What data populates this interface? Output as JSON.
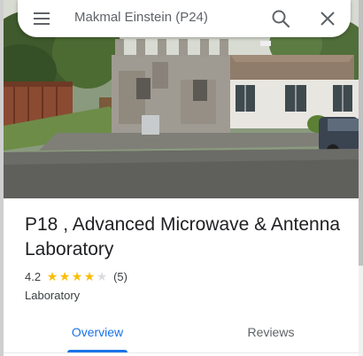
{
  "search": {
    "query": "Makmal Einstein (P24)"
  },
  "icons": {
    "menu": "hamburger-menu-icon",
    "search": "search-icon",
    "close": "close-icon"
  },
  "place": {
    "title": "P18 , Advanced Microwave & Antenna Laboratory",
    "rating": "4.2",
    "stars": 4,
    "max_stars": 5,
    "review_count": "(5)",
    "category": "Laboratory"
  },
  "tabs": [
    {
      "label": "Overview",
      "active": true
    },
    {
      "label": "Reviews",
      "active": false
    }
  ],
  "colors": {
    "accent": "#1a73e8",
    "star": "#fbbc04",
    "title": "#202124"
  }
}
